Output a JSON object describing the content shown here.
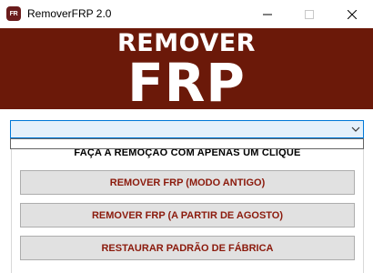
{
  "window": {
    "title": "RemoverFRP 2.0",
    "icon_label": "FR"
  },
  "banner": {
    "line1": "REMOVER",
    "line2": "FRP",
    "background_color": "#6b1909"
  },
  "device_selector": {
    "value": ""
  },
  "actions": {
    "caption": "FAÇA A REMOÇÃO COM APENAS UM CLIQUE",
    "buttons": [
      {
        "label": "REMOVER FRP (MODO ANTIGO)"
      },
      {
        "label": "REMOVER FRP (A PARTIR DE AGOSTO)"
      },
      {
        "label": "RESTAURAR PADRÃO DE FÁBRICA"
      }
    ],
    "button_text_color": "#8b1a0c"
  }
}
